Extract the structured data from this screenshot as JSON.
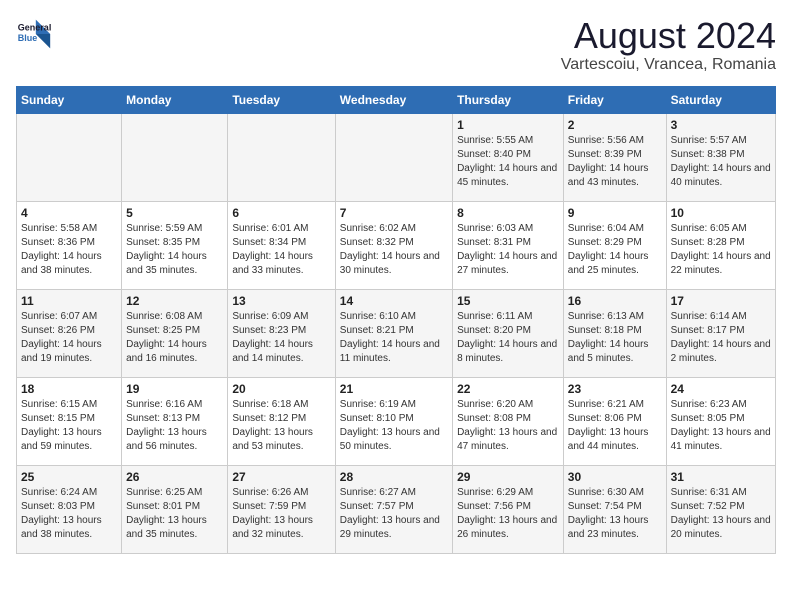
{
  "logo": {
    "line1": "General",
    "line2": "Blue"
  },
  "title": "August 2024",
  "subtitle": "Vartescoiu, Vrancea, Romania",
  "weekdays": [
    "Sunday",
    "Monday",
    "Tuesday",
    "Wednesday",
    "Thursday",
    "Friday",
    "Saturday"
  ],
  "weeks": [
    [
      {
        "day": "",
        "info": ""
      },
      {
        "day": "",
        "info": ""
      },
      {
        "day": "",
        "info": ""
      },
      {
        "day": "",
        "info": ""
      },
      {
        "day": "1",
        "info": "Sunrise: 5:55 AM\nSunset: 8:40 PM\nDaylight: 14 hours and 45 minutes."
      },
      {
        "day": "2",
        "info": "Sunrise: 5:56 AM\nSunset: 8:39 PM\nDaylight: 14 hours and 43 minutes."
      },
      {
        "day": "3",
        "info": "Sunrise: 5:57 AM\nSunset: 8:38 PM\nDaylight: 14 hours and 40 minutes."
      }
    ],
    [
      {
        "day": "4",
        "info": "Sunrise: 5:58 AM\nSunset: 8:36 PM\nDaylight: 14 hours and 38 minutes."
      },
      {
        "day": "5",
        "info": "Sunrise: 5:59 AM\nSunset: 8:35 PM\nDaylight: 14 hours and 35 minutes."
      },
      {
        "day": "6",
        "info": "Sunrise: 6:01 AM\nSunset: 8:34 PM\nDaylight: 14 hours and 33 minutes."
      },
      {
        "day": "7",
        "info": "Sunrise: 6:02 AM\nSunset: 8:32 PM\nDaylight: 14 hours and 30 minutes."
      },
      {
        "day": "8",
        "info": "Sunrise: 6:03 AM\nSunset: 8:31 PM\nDaylight: 14 hours and 27 minutes."
      },
      {
        "day": "9",
        "info": "Sunrise: 6:04 AM\nSunset: 8:29 PM\nDaylight: 14 hours and 25 minutes."
      },
      {
        "day": "10",
        "info": "Sunrise: 6:05 AM\nSunset: 8:28 PM\nDaylight: 14 hours and 22 minutes."
      }
    ],
    [
      {
        "day": "11",
        "info": "Sunrise: 6:07 AM\nSunset: 8:26 PM\nDaylight: 14 hours and 19 minutes."
      },
      {
        "day": "12",
        "info": "Sunrise: 6:08 AM\nSunset: 8:25 PM\nDaylight: 14 hours and 16 minutes."
      },
      {
        "day": "13",
        "info": "Sunrise: 6:09 AM\nSunset: 8:23 PM\nDaylight: 14 hours and 14 minutes."
      },
      {
        "day": "14",
        "info": "Sunrise: 6:10 AM\nSunset: 8:21 PM\nDaylight: 14 hours and 11 minutes."
      },
      {
        "day": "15",
        "info": "Sunrise: 6:11 AM\nSunset: 8:20 PM\nDaylight: 14 hours and 8 minutes."
      },
      {
        "day": "16",
        "info": "Sunrise: 6:13 AM\nSunset: 8:18 PM\nDaylight: 14 hours and 5 minutes."
      },
      {
        "day": "17",
        "info": "Sunrise: 6:14 AM\nSunset: 8:17 PM\nDaylight: 14 hours and 2 minutes."
      }
    ],
    [
      {
        "day": "18",
        "info": "Sunrise: 6:15 AM\nSunset: 8:15 PM\nDaylight: 13 hours and 59 minutes."
      },
      {
        "day": "19",
        "info": "Sunrise: 6:16 AM\nSunset: 8:13 PM\nDaylight: 13 hours and 56 minutes."
      },
      {
        "day": "20",
        "info": "Sunrise: 6:18 AM\nSunset: 8:12 PM\nDaylight: 13 hours and 53 minutes."
      },
      {
        "day": "21",
        "info": "Sunrise: 6:19 AM\nSunset: 8:10 PM\nDaylight: 13 hours and 50 minutes."
      },
      {
        "day": "22",
        "info": "Sunrise: 6:20 AM\nSunset: 8:08 PM\nDaylight: 13 hours and 47 minutes."
      },
      {
        "day": "23",
        "info": "Sunrise: 6:21 AM\nSunset: 8:06 PM\nDaylight: 13 hours and 44 minutes."
      },
      {
        "day": "24",
        "info": "Sunrise: 6:23 AM\nSunset: 8:05 PM\nDaylight: 13 hours and 41 minutes."
      }
    ],
    [
      {
        "day": "25",
        "info": "Sunrise: 6:24 AM\nSunset: 8:03 PM\nDaylight: 13 hours and 38 minutes."
      },
      {
        "day": "26",
        "info": "Sunrise: 6:25 AM\nSunset: 8:01 PM\nDaylight: 13 hours and 35 minutes."
      },
      {
        "day": "27",
        "info": "Sunrise: 6:26 AM\nSunset: 7:59 PM\nDaylight: 13 hours and 32 minutes."
      },
      {
        "day": "28",
        "info": "Sunrise: 6:27 AM\nSunset: 7:57 PM\nDaylight: 13 hours and 29 minutes."
      },
      {
        "day": "29",
        "info": "Sunrise: 6:29 AM\nSunset: 7:56 PM\nDaylight: 13 hours and 26 minutes."
      },
      {
        "day": "30",
        "info": "Sunrise: 6:30 AM\nSunset: 7:54 PM\nDaylight: 13 hours and 23 minutes."
      },
      {
        "day": "31",
        "info": "Sunrise: 6:31 AM\nSunset: 7:52 PM\nDaylight: 13 hours and 20 minutes."
      }
    ]
  ]
}
